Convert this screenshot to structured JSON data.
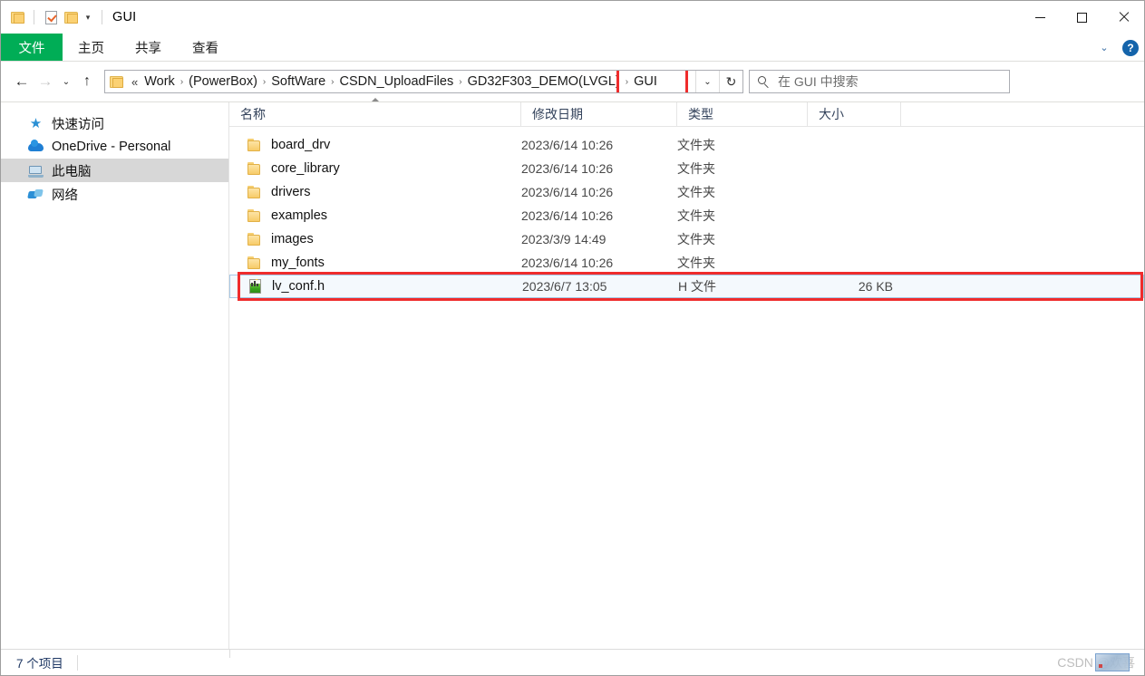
{
  "window": {
    "title": "GUI",
    "quick_access": [
      {
        "name": "folder-icon",
        "label": ""
      },
      {
        "name": "properties-icon",
        "label": ""
      },
      {
        "name": "new-folder-icon",
        "label": ""
      }
    ],
    "controls": {
      "minimize": "–",
      "maximize": "☐",
      "close": "✕"
    }
  },
  "ribbon": {
    "tabs": [
      {
        "label": "文件",
        "active": true
      },
      {
        "label": "主页",
        "active": false
      },
      {
        "label": "共享",
        "active": false
      },
      {
        "label": "查看",
        "active": false
      }
    ],
    "collapse_icon": "⌄",
    "help_label": "?",
    "accent_green": "#00ad56"
  },
  "address": {
    "back_icon": "←",
    "forward_icon": "→",
    "recent_icon": "⌄",
    "up_icon": "↑",
    "ellipsis": "«",
    "separator": "›",
    "crumbs": [
      "Work",
      "(PowerBox)",
      "SoftWare",
      "CSDN_UploadFiles",
      "GD32F303_DEMO(LVGL)",
      "GUI"
    ],
    "highlighted_crumb": "GUI",
    "dropdown_icon": "⌄",
    "refresh_icon": "↻",
    "highlight_color": "#ef2c2c"
  },
  "search": {
    "placeholder": "在 GUI 中搜索",
    "icon": "search-icon"
  },
  "sidebar": {
    "items": [
      {
        "label": "快速访问",
        "icon": "star-icon",
        "selected": false
      },
      {
        "label": "OneDrive - Personal",
        "icon": "cloud-icon",
        "selected": false
      },
      {
        "label": "此电脑",
        "icon": "computer-icon",
        "selected": true
      },
      {
        "label": "网络",
        "icon": "network-icon",
        "selected": false
      }
    ]
  },
  "filelist": {
    "columns": [
      {
        "label": "名称",
        "sorted": "asc"
      },
      {
        "label": "修改日期",
        "sorted": ""
      },
      {
        "label": "类型",
        "sorted": ""
      },
      {
        "label": "大小",
        "sorted": ""
      }
    ],
    "rows": [
      {
        "name": "board_drv",
        "date": "2023/6/14 10:26",
        "type": "文件夹",
        "size": "",
        "icon": "folder-icon",
        "selected": false,
        "highlighted": false
      },
      {
        "name": "core_library",
        "date": "2023/6/14 10:26",
        "type": "文件夹",
        "size": "",
        "icon": "folder-icon",
        "selected": false,
        "highlighted": false
      },
      {
        "name": "drivers",
        "date": "2023/6/14 10:26",
        "type": "文件夹",
        "size": "",
        "icon": "folder-icon",
        "selected": false,
        "highlighted": false
      },
      {
        "name": "examples",
        "date": "2023/6/14 10:26",
        "type": "文件夹",
        "size": "",
        "icon": "folder-icon",
        "selected": false,
        "highlighted": false
      },
      {
        "name": "images",
        "date": "2023/3/9 14:49",
        "type": "文件夹",
        "size": "",
        "icon": "folder-icon",
        "selected": false,
        "highlighted": false
      },
      {
        "name": "my_fonts",
        "date": "2023/6/14 10:26",
        "type": "文件夹",
        "size": "",
        "icon": "folder-icon",
        "selected": false,
        "highlighted": false
      },
      {
        "name": "lv_conf.h",
        "date": "2023/6/7 13:05",
        "type": "H 文件",
        "size": "26 KB",
        "icon": "h-file-icon",
        "selected": true,
        "highlighted": true
      }
    ]
  },
  "status": {
    "item_count": "7 个项目",
    "watermark": "CSDN @欢喜"
  }
}
